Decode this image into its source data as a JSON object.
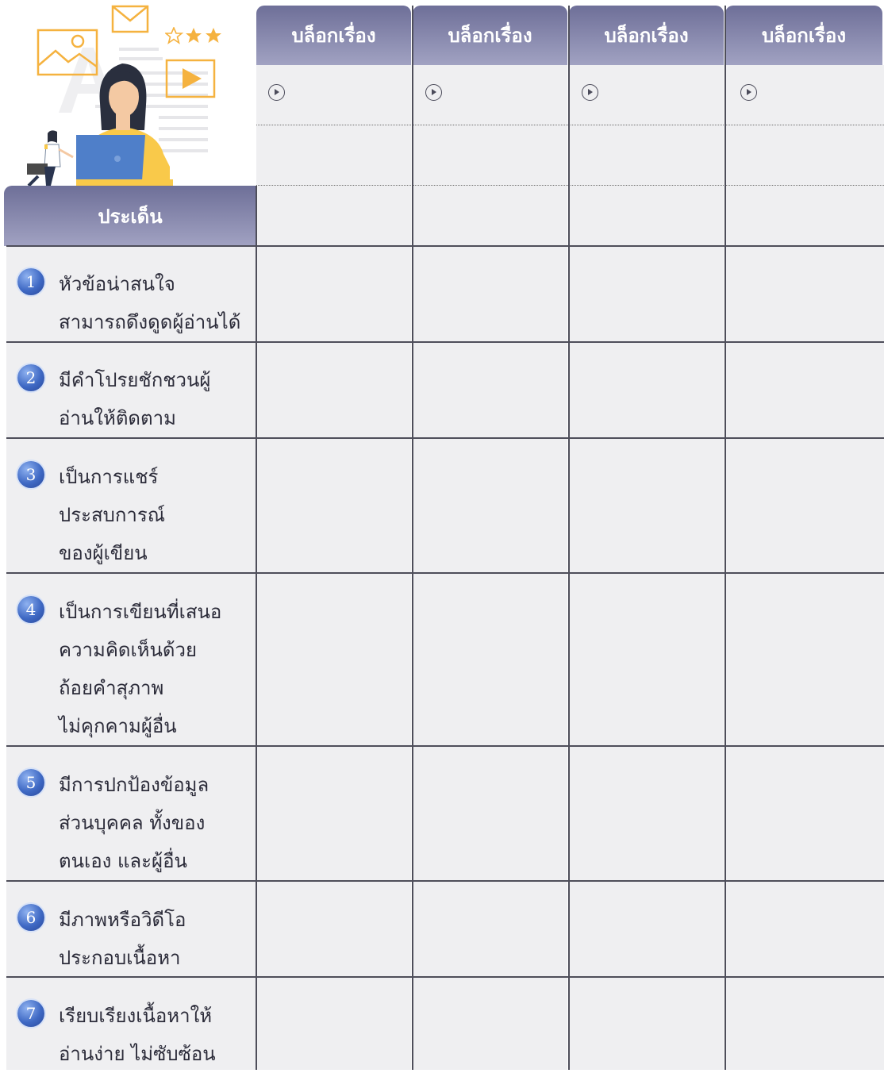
{
  "table": {
    "blog_headers": [
      "บล็อกเรื่อง",
      "บล็อกเรื่อง",
      "บล็อกเรื่อง",
      "บล็อกเรื่อง"
    ],
    "topic_header": "ประเด็น",
    "topics": [
      {
        "number": "1",
        "lines": [
          "หัวข้อน่าสนใจ",
          "สามารถดึงดูดผู้อ่านได้"
        ]
      },
      {
        "number": "2",
        "lines": [
          "มีคำโปรยชักชวนผู้",
          "อ่านให้ติดตาม"
        ]
      },
      {
        "number": "3",
        "lines": [
          "เป็นการแชร์",
          "ประสบการณ์",
          "ของผู้เขียน"
        ]
      },
      {
        "number": "4",
        "lines": [
          "เป็นการเขียนที่เสนอ",
          "ความคิดเห็นด้วย",
          "ถ้อยคำสุภาพ",
          "ไม่คุกคามผู้อื่น"
        ]
      },
      {
        "number": "5",
        "lines": [
          "มีการปกป้องข้อมูล",
          "ส่วนบุคคล ทั้งของ",
          "ตนเอง และผู้อื่น"
        ]
      },
      {
        "number": "6",
        "lines": [
          "มีภาพหรือวิดีโอ",
          "ประกอบเนื้อหา"
        ]
      },
      {
        "number": "7",
        "lines": [
          "เรียบเรียงเนื้อหาให้",
          "อ่านง่าย ไม่ซับซ้อน"
        ]
      }
    ]
  },
  "icons": [
    "play-circle-icon",
    "envelope-icon",
    "image-icon",
    "video-play-icon",
    "star-icon"
  ],
  "colors": {
    "header_gradient_top": "#6e6f98",
    "header_gradient_bottom": "#a1a2c2",
    "cell_background": "#efeff1",
    "grid_line": "#4e4e5a",
    "number_badge": "#3f69c4",
    "illustration_orange": "#f5b23f",
    "illustration_yellow": "#f9c94a",
    "laptop_blue": "#4f7fc9"
  }
}
